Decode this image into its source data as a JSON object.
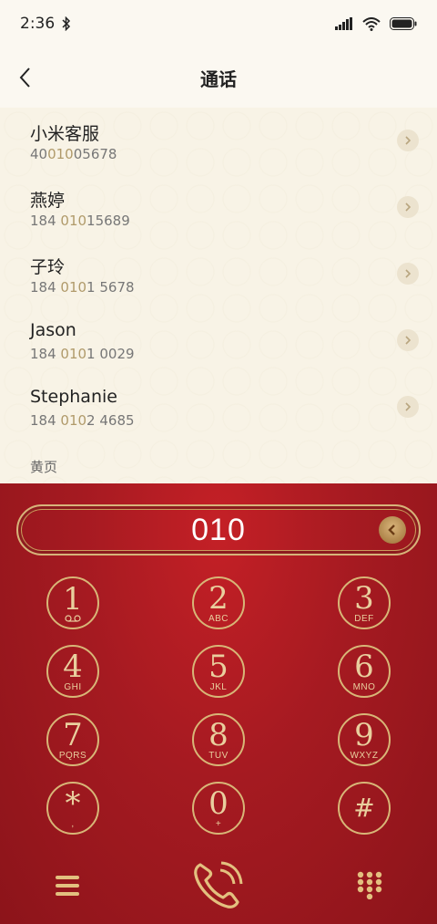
{
  "status_bar": {
    "time": "2:36"
  },
  "header": {
    "title": "通话"
  },
  "contacts": [
    {
      "name": "小米客服",
      "num_pre": "40",
      "num_hl": "010",
      "num_post": "05678"
    },
    {
      "name": "燕婷",
      "num_pre": "184 ",
      "num_hl": "010",
      "num_post": "15689"
    },
    {
      "name": "子玲",
      "num_pre": "184 ",
      "num_hl": "010",
      "num_post": "1 5678"
    },
    {
      "name": "Jason",
      "num_pre": "184 ",
      "num_hl": "010",
      "num_post": "1 0029"
    },
    {
      "name": "Stephanie",
      "num_pre": "184 ",
      "num_hl": "010",
      "num_post": "2 4685"
    }
  ],
  "section_label": "黄页",
  "dialer": {
    "input_value": "010",
    "keys": [
      {
        "digit": "1",
        "letters": ""
      },
      {
        "digit": "2",
        "letters": "ABC"
      },
      {
        "digit": "3",
        "letters": "DEF"
      },
      {
        "digit": "4",
        "letters": "GHI"
      },
      {
        "digit": "5",
        "letters": "JKL"
      },
      {
        "digit": "6",
        "letters": "MNO"
      },
      {
        "digit": "7",
        "letters": "PQRS"
      },
      {
        "digit": "8",
        "letters": "TUV"
      },
      {
        "digit": "9",
        "letters": "WXYZ"
      },
      {
        "digit": "*",
        "letters": ","
      },
      {
        "digit": "0",
        "letters": "+"
      },
      {
        "digit": "#",
        "letters": ""
      }
    ]
  },
  "colors": {
    "accent_gold": "#d8b677",
    "dialer_red": "#a51a21",
    "list_bg": "#f8f3e6"
  }
}
